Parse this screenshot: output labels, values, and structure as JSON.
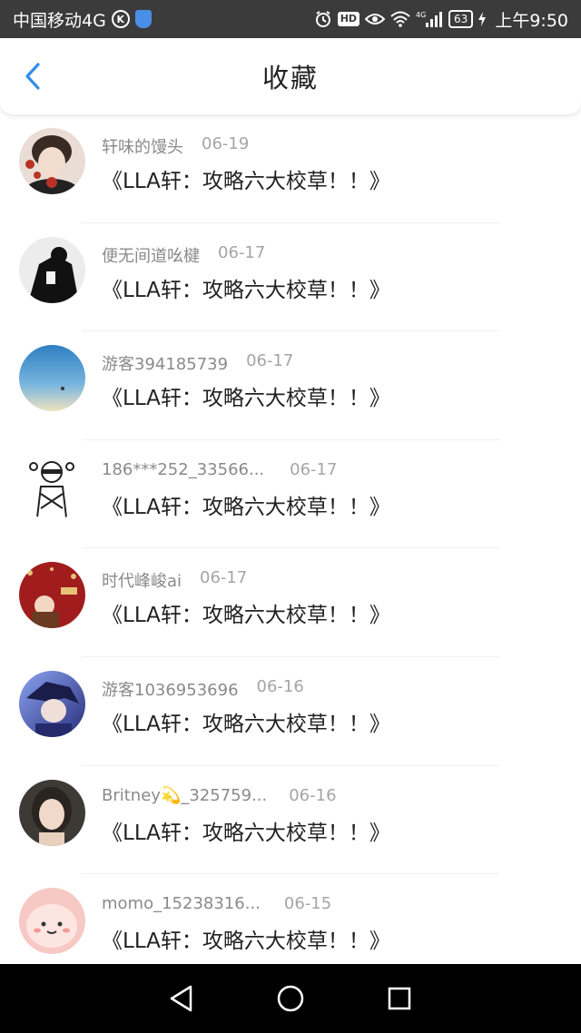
{
  "status_bar": {
    "carrier": "中国移动4G",
    "k_badge": "K",
    "hd_label": "HD",
    "network_label": "4G",
    "battery": "63",
    "time": "上午9:50",
    "icons": [
      "k-icon",
      "shield-icon",
      "alarm-icon",
      "hd-icon",
      "eye-icon",
      "wifi-icon",
      "signal-icon",
      "battery-icon",
      "charging-icon"
    ]
  },
  "header": {
    "title": "收藏",
    "back_icon": "chevron-left-icon",
    "accent_color": "#2f8fe6"
  },
  "favorites": [
    {
      "username": "轩味的馒头",
      "date": "06-19",
      "title": "《LLA轩：攻略六大校草！！》",
      "avatar_colors": [
        "#e9ddd6",
        "#b83225"
      ]
    },
    {
      "username": "便无间道吆楗",
      "date": "06-17",
      "title": "《LLA轩：攻略六大校草！！》",
      "avatar_colors": [
        "#e8e8e8",
        "#111111"
      ]
    },
    {
      "username": "游客394185739",
      "date": "06-17",
      "title": "《LLA轩：攻略六大校草！！》",
      "avatar_colors": [
        "#3f8fc9",
        "#e8e0c6"
      ]
    },
    {
      "username": "186***252_33566...",
      "date": "06-17",
      "title": "《LLA轩：攻略六大校草！！》",
      "avatar_colors": [
        "#ffffff",
        "#222222"
      ]
    },
    {
      "username": "时代峰峻ai",
      "date": "06-17",
      "title": "《LLA轩：攻略六大校草！！》",
      "avatar_colors": [
        "#a11d1d",
        "#e7c27a"
      ]
    },
    {
      "username": "游客1036953696",
      "date": "06-16",
      "title": "《LLA轩：攻略六大校草！！》",
      "avatar_colors": [
        "#2a2f7c",
        "#8aa3f0"
      ]
    },
    {
      "username": "Britney💫_325759...",
      "date": "06-16",
      "title": "《LLA轩：攻略六大校草！！》",
      "avatar_colors": [
        "#3d3a36",
        "#e8cfbe"
      ]
    },
    {
      "username": "momo_15238316...",
      "date": "06-15",
      "title": "《LLA轩：攻略六大校草！！》",
      "avatar_colors": [
        "#f7c9c4",
        "#ffffff"
      ]
    }
  ],
  "nav_bar": {
    "icons": [
      "back-triangle-icon",
      "home-circle-icon",
      "recents-square-icon"
    ]
  }
}
